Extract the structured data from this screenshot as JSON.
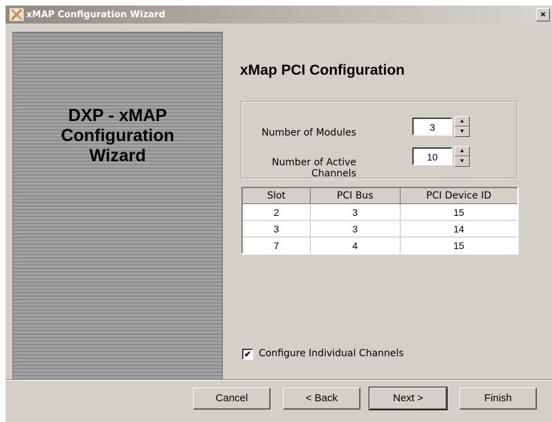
{
  "window": {
    "title": "xMAP Configuration Wizard",
    "close_label": "×"
  },
  "side_panel": {
    "line1": "DXP - xMAP",
    "line2": "Configuration",
    "line3": "Wizard"
  },
  "page": {
    "title": "xMap PCI Configuration"
  },
  "modules": {
    "label": "Number of Modules",
    "value": "3"
  },
  "channels": {
    "label": "Number of Active Channels",
    "value": "10"
  },
  "spinner": {
    "up_glyph": "▲",
    "down_glyph": "▼"
  },
  "table": {
    "headers": [
      "Slot",
      "PCI Bus",
      "PCI Device ID"
    ],
    "rows": [
      [
        "2",
        "3",
        "15"
      ],
      [
        "3",
        "3",
        "14"
      ],
      [
        "7",
        "4",
        "15"
      ]
    ]
  },
  "options": {
    "configure_individual_label": "Configure Individual Channels",
    "configure_individual_checked": true,
    "check_glyph": "✔"
  },
  "buttons": {
    "cancel": "Cancel",
    "back": "< Back",
    "next": "Next >",
    "finish": "Finish"
  }
}
